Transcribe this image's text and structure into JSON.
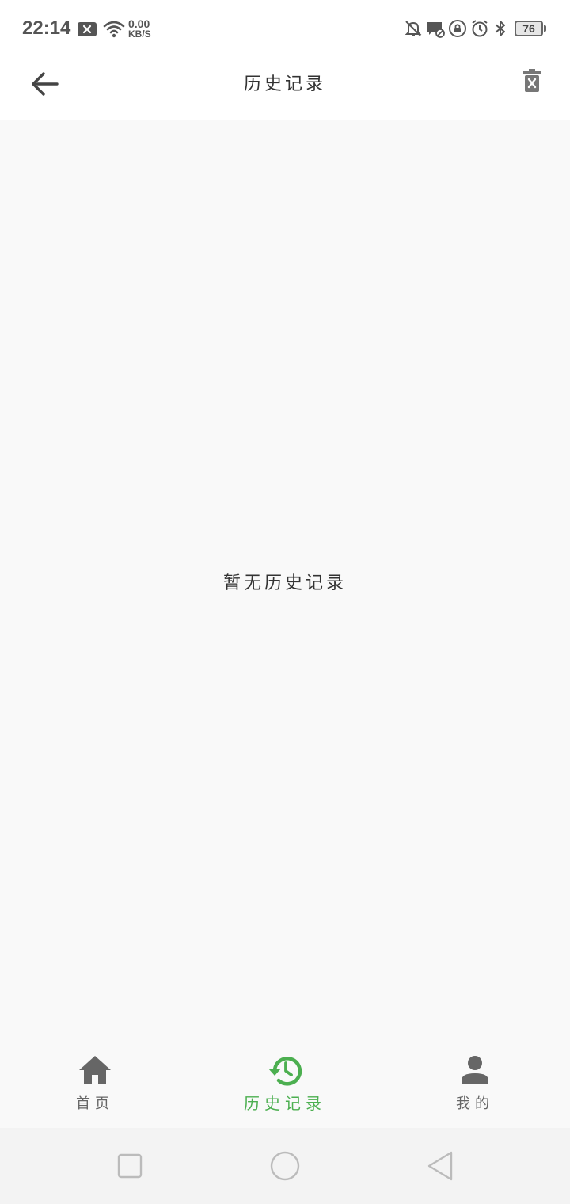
{
  "status_bar": {
    "time": "22:14",
    "net_speed_value": "0.00",
    "net_speed_unit": "KB/S",
    "battery": "76",
    "icons": [
      "notification-x-icon",
      "wifi-icon",
      "mute-bell-icon",
      "chat-off-icon",
      "lock-rotation-icon",
      "alarm-icon",
      "bluetooth-icon",
      "battery-icon"
    ]
  },
  "header": {
    "title": "历史记录",
    "back_icon": "arrow-left-icon",
    "clear_icon": "trash-x-icon"
  },
  "main": {
    "empty_text": "暂无历史记录"
  },
  "bottom_nav": {
    "items": [
      {
        "label": "首页",
        "icon": "home-icon",
        "active": false
      },
      {
        "label": "历史记录",
        "icon": "history-icon",
        "active": true
      },
      {
        "label": "我的",
        "icon": "person-icon",
        "active": false
      }
    ],
    "active_color": "#4caf50",
    "inactive_color": "#666666"
  },
  "system_nav": {
    "buttons": [
      "recents-square-icon",
      "home-circle-icon",
      "back-triangle-icon"
    ]
  }
}
